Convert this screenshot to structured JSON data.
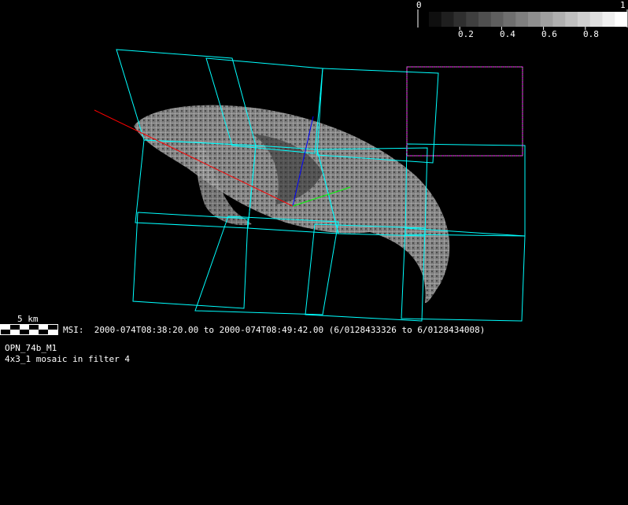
{
  "colorbar": {
    "min_label": "0",
    "max_label": "1",
    "ticks": [
      "0.2",
      "0.4",
      "0.6",
      "0.8"
    ],
    "steps": 16
  },
  "scale_bar": {
    "label": "5 km"
  },
  "observation": {
    "instrument_line": "MSI:  2000-074T08:38:20.00 to 2000-074T08:49:42.00 (6/0128433326 to 6/0128434008)",
    "sequence_name": "OPN_74b_M1",
    "description": "4x3_1 mosaic in filter 4"
  },
  "colors": {
    "frame": "#00ffff",
    "selected_frame": "#ff00ff",
    "axis_x": "#ff0000",
    "axis_y": "#00ff00",
    "axis_z": "#0000ff",
    "background": "#000000"
  }
}
